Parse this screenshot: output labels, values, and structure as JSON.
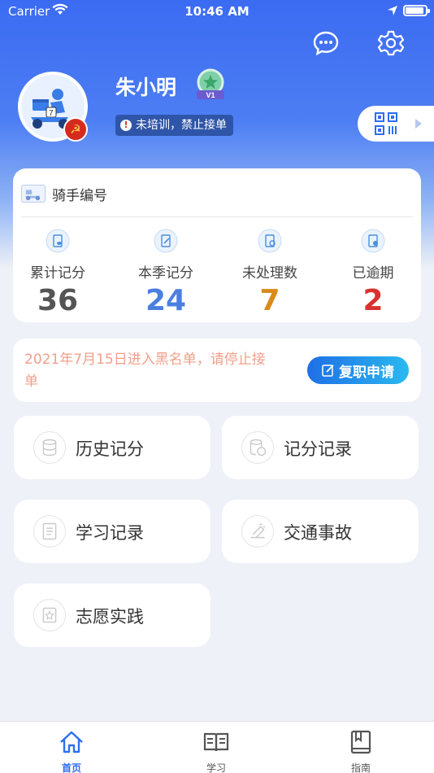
{
  "status_bar": {
    "carrier": "Carrier",
    "time": "10:46 AM"
  },
  "profile": {
    "name": "朱小明",
    "level": "V1",
    "warning": "未培训，禁止接单"
  },
  "stats_card": {
    "rider_label": "骑手编号",
    "items": [
      {
        "label": "累计记分",
        "value": "36",
        "color": "#555555"
      },
      {
        "label": "本季记分",
        "value": "24",
        "color": "#4a7fe0"
      },
      {
        "label": "未处理数",
        "value": "7",
        "color": "#d98a1a"
      },
      {
        "label": "已逾期",
        "value": "2",
        "color": "#d8332f"
      }
    ]
  },
  "notice": {
    "text": "2021年7月15日进入黑名单，请停止接单",
    "button": "复职申请"
  },
  "menu": [
    {
      "label": "历史记分",
      "icon": "database-icon"
    },
    {
      "label": "记分记录",
      "icon": "score-record-icon"
    },
    {
      "label": "学习记录",
      "icon": "notebook-icon"
    },
    {
      "label": "交通事故",
      "icon": "accident-icon"
    },
    {
      "label": "志愿实践",
      "icon": "volunteer-icon"
    }
  ],
  "tabs": [
    {
      "label": "首页",
      "active": true
    },
    {
      "label": "学习",
      "active": false
    },
    {
      "label": "指南",
      "active": false
    }
  ],
  "colors": {
    "accent": "#2e6ef0",
    "notice_text": "#f0a08a"
  }
}
